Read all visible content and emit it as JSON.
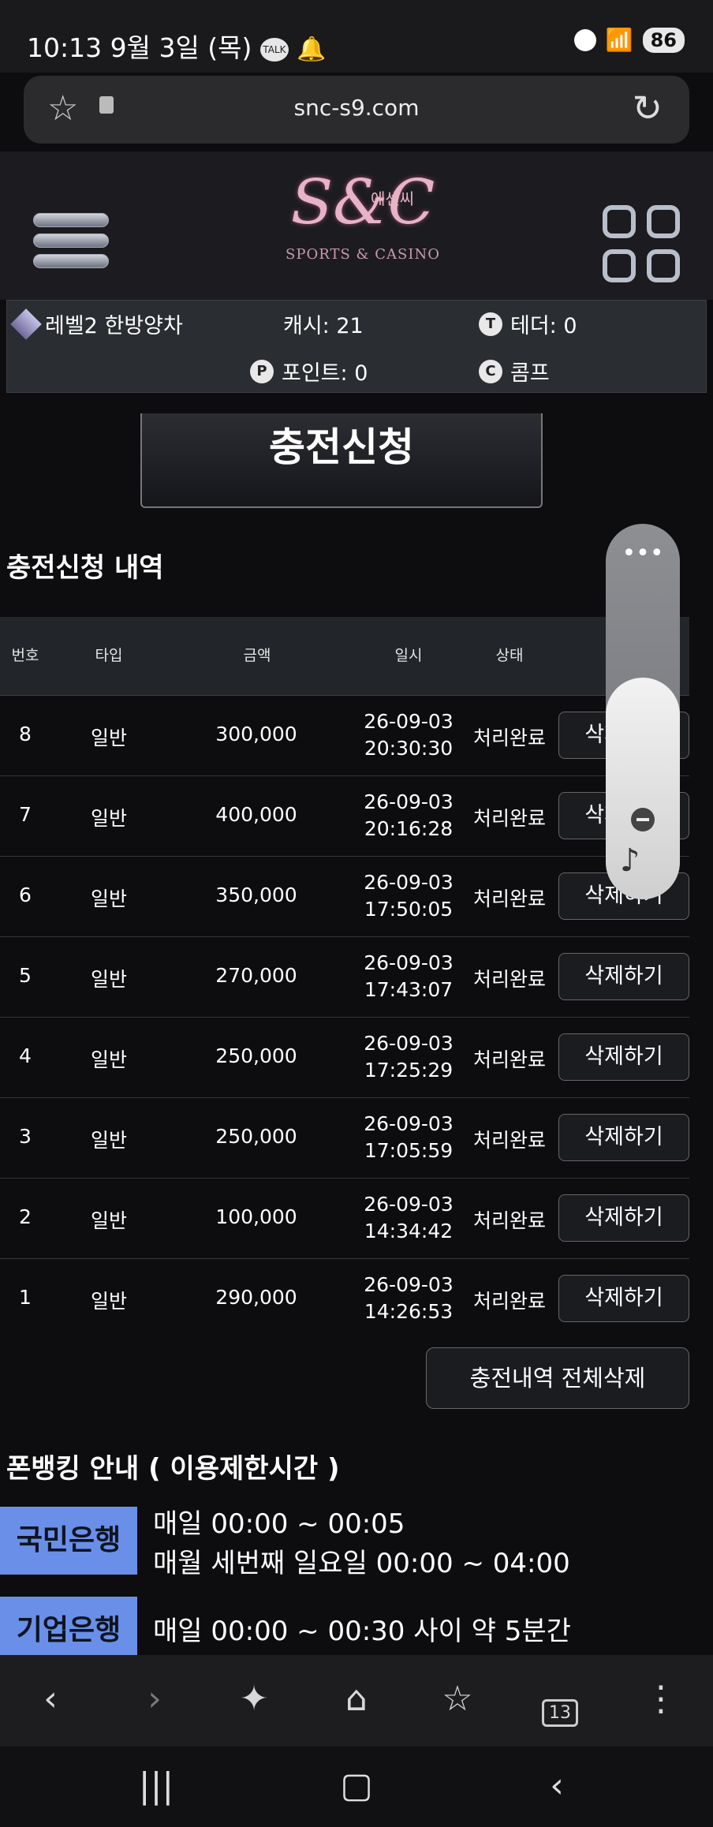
{
  "status": {
    "time": "10:13",
    "date": "9월 3일 (목)",
    "battery": "86"
  },
  "browser": {
    "url": "snc-s9.com"
  },
  "header": {
    "logo_main": "S&C",
    "logo_korean": "에센씨",
    "logo_sub": "SPORTS & CASINO"
  },
  "user_info": {
    "level": "레벨2 한방양차",
    "cash": "캐시: 21",
    "tether": "테더: 0",
    "points": "포인트: 0",
    "comp": "콤프"
  },
  "charge_button": "충전신청",
  "history": {
    "title": "충전신청 내역",
    "columns": {
      "no": "번호",
      "type": "타입",
      "amount": "금액",
      "date": "일시",
      "status": "상태"
    },
    "rows": [
      {
        "no": "8",
        "type": "일반",
        "amount": "300,000",
        "date": "26-09-03",
        "time": "20:30:30",
        "status": "처리완료",
        "action": "삭제하기"
      },
      {
        "no": "7",
        "type": "일반",
        "amount": "400,000",
        "date": "26-09-03",
        "time": "20:16:28",
        "status": "처리완료",
        "action": "삭제하기"
      },
      {
        "no": "6",
        "type": "일반",
        "amount": "350,000",
        "date": "26-09-03",
        "time": "17:50:05",
        "status": "처리완료",
        "action": "삭제하기"
      },
      {
        "no": "5",
        "type": "일반",
        "amount": "270,000",
        "date": "26-09-03",
        "time": "17:43:07",
        "status": "처리완료",
        "action": "삭제하기"
      },
      {
        "no": "4",
        "type": "일반",
        "amount": "250,000",
        "date": "26-09-03",
        "time": "17:25:29",
        "status": "처리완료",
        "action": "삭제하기"
      },
      {
        "no": "3",
        "type": "일반",
        "amount": "250,000",
        "date": "26-09-03",
        "time": "17:05:59",
        "status": "처리완료",
        "action": "삭제하기"
      },
      {
        "no": "2",
        "type": "일반",
        "amount": "100,000",
        "date": "26-09-03",
        "time": "14:34:42",
        "status": "처리완료",
        "action": "삭제하기"
      },
      {
        "no": "1",
        "type": "일반",
        "amount": "290,000",
        "date": "26-09-03",
        "time": "14:26:53",
        "status": "처리완료",
        "action": "삭제하기"
      }
    ],
    "delete_all": "충전내역 전체삭제"
  },
  "phonebanking": {
    "title": "폰뱅킹 안내 ( 이용제한시간 )",
    "banks": [
      {
        "name": "국민은행",
        "line1": "매일 00:00 ~ 00:05",
        "line2": "매월 세번째 일요일 00:00 ~ 04:00"
      },
      {
        "name": "기업은행",
        "line1": "매일 00:00 ~ 00:30 사이 약 5분간"
      }
    ]
  },
  "volume": {
    "menu": "•••",
    "level_percent": 59
  },
  "tabs_count": "13",
  "colors": {
    "bank_label": "#6a8fe8",
    "background": "#0d0d0f"
  }
}
